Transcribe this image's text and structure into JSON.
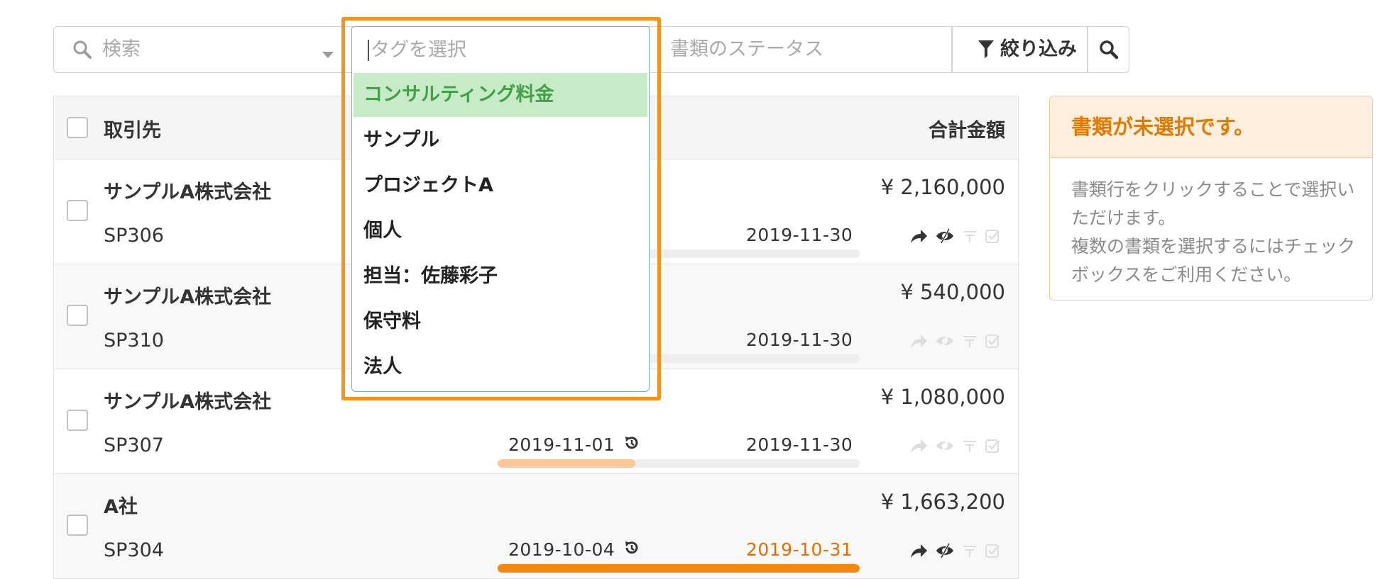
{
  "filter_bar": {
    "search_placeholder": "検索",
    "tag_placeholder": "タグを選択",
    "status_placeholder": "書類のステータス",
    "filter_button_label": "絞り込み"
  },
  "tag_dropdown": {
    "options": [
      "コンサルティング料金",
      "サンプル",
      "プロジェクトA",
      "個人",
      "担当：佐藤彩子",
      "保守料",
      "法人"
    ],
    "highlighted_index": 0
  },
  "table": {
    "headers": {
      "client": "取引先",
      "total": "合計金額"
    },
    "rows": [
      {
        "client": "サンプルA株式会社",
        "doc_no": "SP306",
        "issue_date": "",
        "due_date": "2019-11-30",
        "amount": "¥ 2,160,000",
        "progress": 0,
        "overdue": false,
        "icons_active": true
      },
      {
        "client": "サンプルA株式会社",
        "doc_no": "SP310",
        "issue_date": "",
        "due_date": "2019-11-30",
        "amount": "¥ 540,000",
        "progress": 0,
        "overdue": false,
        "icons_active": false
      },
      {
        "client": "サンプルA株式会社",
        "doc_no": "SP307",
        "issue_date": "2019-11-01",
        "due_date": "2019-11-30",
        "amount": "¥ 1,080,000",
        "progress": 0.38,
        "overdue": false,
        "icons_active": false
      },
      {
        "client": "A社",
        "doc_no": "SP304",
        "issue_date": "2019-10-04",
        "due_date": "2019-10-31",
        "amount": "¥ 1,663,200",
        "progress": 1,
        "overdue": true,
        "icons_active": true
      }
    ]
  },
  "notice": {
    "title": "書類が未選択です。",
    "body": "書類行をクリックすることで選択いただけます。\n複数の書類を選択するにはチェックボックスをご利用ください。"
  },
  "colors": {
    "dropdown_highlight_border": "#f6921e",
    "active_option_bg": "#c6ebc6",
    "active_option_text": "#43a047",
    "progress_partial": "#fcc898",
    "progress_overdue": "#f5870c",
    "overdue_text": "#e06f00",
    "notice_title": "#e07a00"
  },
  "icons": [
    "search-icon",
    "dropdown-caret-icon",
    "filter-icon",
    "history-icon",
    "forward-icon",
    "hidden-eye-icon",
    "filter-small-icon",
    "check-square-icon"
  ]
}
